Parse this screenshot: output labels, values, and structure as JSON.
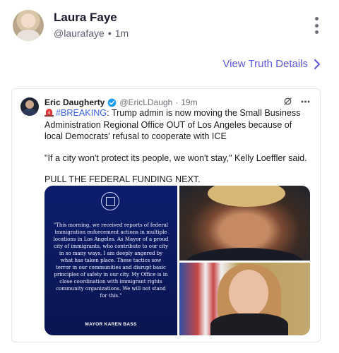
{
  "post": {
    "author_name": "Laura Faye",
    "author_handle": "@laurafaye",
    "separator": "•",
    "time": "1m",
    "view_details_label": "View Truth Details"
  },
  "quoted": {
    "author_name": "Eric Daugherty",
    "author_handle": "@EricLDaugh",
    "separator": "·",
    "time": "19m",
    "hashtag": "#BREAKING",
    "text_after_hashtag": ": Trump admin is now moving the Small Business Administration Regional Office OUT of Los Angeles because of local Democrats' refusal to cooperate with ICE",
    "quote_line": "\"If a city won't protect its people, we won't stay,\" Kelly Loeffler said.",
    "closing_line": "PULL THE FEDERAL FUNDING NEXT.",
    "statement_text": "\"This morning, we received reports of federal immigration enforcement actions in multiple locations in Los Angeles. As Mayor of a proud city of immigrants, who contribute to our city in so many ways, I am deeply angered by what has taken place. These tactics sow terror in our communities and disrupt basic principles of safety in our city. My Office is in close coordination with immigrant rights community organizations. We will not stand for this.\"",
    "statement_signature": "MAYOR KAREN BASS"
  },
  "icons": {
    "more": "more-vertical-icon",
    "chevron": "chevron-right-icon",
    "verified": "verified-badge-icon",
    "grok": "grok-icon",
    "more_horizontal": "more-horizontal-icon",
    "siren": "siren-icon"
  },
  "colors": {
    "link": "#5b59d6",
    "hashtag": "#3b63d8",
    "verified": "#1d9bf0",
    "statement_bg": "#0d1d6d"
  }
}
